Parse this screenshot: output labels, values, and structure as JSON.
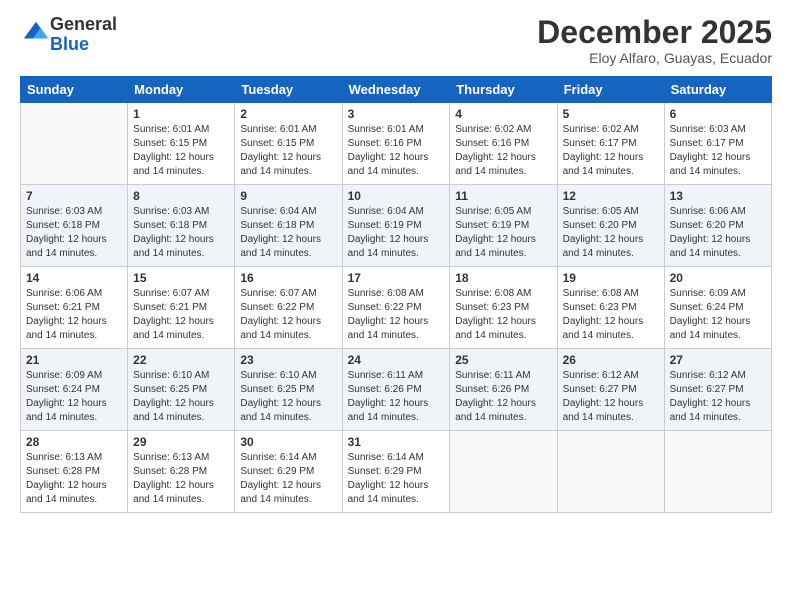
{
  "logo": {
    "general": "General",
    "blue": "Blue"
  },
  "header": {
    "month": "December 2025",
    "location": "Eloy Alfaro, Guayas, Ecuador"
  },
  "weekdays": [
    "Sunday",
    "Monday",
    "Tuesday",
    "Wednesday",
    "Thursday",
    "Friday",
    "Saturday"
  ],
  "weeks": [
    [
      {
        "day": "",
        "sunrise": "",
        "sunset": "",
        "daylight": ""
      },
      {
        "day": "1",
        "sunrise": "Sunrise: 6:01 AM",
        "sunset": "Sunset: 6:15 PM",
        "daylight": "Daylight: 12 hours and 14 minutes."
      },
      {
        "day": "2",
        "sunrise": "Sunrise: 6:01 AM",
        "sunset": "Sunset: 6:15 PM",
        "daylight": "Daylight: 12 hours and 14 minutes."
      },
      {
        "day": "3",
        "sunrise": "Sunrise: 6:01 AM",
        "sunset": "Sunset: 6:16 PM",
        "daylight": "Daylight: 12 hours and 14 minutes."
      },
      {
        "day": "4",
        "sunrise": "Sunrise: 6:02 AM",
        "sunset": "Sunset: 6:16 PM",
        "daylight": "Daylight: 12 hours and 14 minutes."
      },
      {
        "day": "5",
        "sunrise": "Sunrise: 6:02 AM",
        "sunset": "Sunset: 6:17 PM",
        "daylight": "Daylight: 12 hours and 14 minutes."
      },
      {
        "day": "6",
        "sunrise": "Sunrise: 6:03 AM",
        "sunset": "Sunset: 6:17 PM",
        "daylight": "Daylight: 12 hours and 14 minutes."
      }
    ],
    [
      {
        "day": "7",
        "sunrise": "Sunrise: 6:03 AM",
        "sunset": "Sunset: 6:18 PM",
        "daylight": "Daylight: 12 hours and 14 minutes."
      },
      {
        "day": "8",
        "sunrise": "Sunrise: 6:03 AM",
        "sunset": "Sunset: 6:18 PM",
        "daylight": "Daylight: 12 hours and 14 minutes."
      },
      {
        "day": "9",
        "sunrise": "Sunrise: 6:04 AM",
        "sunset": "Sunset: 6:18 PM",
        "daylight": "Daylight: 12 hours and 14 minutes."
      },
      {
        "day": "10",
        "sunrise": "Sunrise: 6:04 AM",
        "sunset": "Sunset: 6:19 PM",
        "daylight": "Daylight: 12 hours and 14 minutes."
      },
      {
        "day": "11",
        "sunrise": "Sunrise: 6:05 AM",
        "sunset": "Sunset: 6:19 PM",
        "daylight": "Daylight: 12 hours and 14 minutes."
      },
      {
        "day": "12",
        "sunrise": "Sunrise: 6:05 AM",
        "sunset": "Sunset: 6:20 PM",
        "daylight": "Daylight: 12 hours and 14 minutes."
      },
      {
        "day": "13",
        "sunrise": "Sunrise: 6:06 AM",
        "sunset": "Sunset: 6:20 PM",
        "daylight": "Daylight: 12 hours and 14 minutes."
      }
    ],
    [
      {
        "day": "14",
        "sunrise": "Sunrise: 6:06 AM",
        "sunset": "Sunset: 6:21 PM",
        "daylight": "Daylight: 12 hours and 14 minutes."
      },
      {
        "day": "15",
        "sunrise": "Sunrise: 6:07 AM",
        "sunset": "Sunset: 6:21 PM",
        "daylight": "Daylight: 12 hours and 14 minutes."
      },
      {
        "day": "16",
        "sunrise": "Sunrise: 6:07 AM",
        "sunset": "Sunset: 6:22 PM",
        "daylight": "Daylight: 12 hours and 14 minutes."
      },
      {
        "day": "17",
        "sunrise": "Sunrise: 6:08 AM",
        "sunset": "Sunset: 6:22 PM",
        "daylight": "Daylight: 12 hours and 14 minutes."
      },
      {
        "day": "18",
        "sunrise": "Sunrise: 6:08 AM",
        "sunset": "Sunset: 6:23 PM",
        "daylight": "Daylight: 12 hours and 14 minutes."
      },
      {
        "day": "19",
        "sunrise": "Sunrise: 6:08 AM",
        "sunset": "Sunset: 6:23 PM",
        "daylight": "Daylight: 12 hours and 14 minutes."
      },
      {
        "day": "20",
        "sunrise": "Sunrise: 6:09 AM",
        "sunset": "Sunset: 6:24 PM",
        "daylight": "Daylight: 12 hours and 14 minutes."
      }
    ],
    [
      {
        "day": "21",
        "sunrise": "Sunrise: 6:09 AM",
        "sunset": "Sunset: 6:24 PM",
        "daylight": "Daylight: 12 hours and 14 minutes."
      },
      {
        "day": "22",
        "sunrise": "Sunrise: 6:10 AM",
        "sunset": "Sunset: 6:25 PM",
        "daylight": "Daylight: 12 hours and 14 minutes."
      },
      {
        "day": "23",
        "sunrise": "Sunrise: 6:10 AM",
        "sunset": "Sunset: 6:25 PM",
        "daylight": "Daylight: 12 hours and 14 minutes."
      },
      {
        "day": "24",
        "sunrise": "Sunrise: 6:11 AM",
        "sunset": "Sunset: 6:26 PM",
        "daylight": "Daylight: 12 hours and 14 minutes."
      },
      {
        "day": "25",
        "sunrise": "Sunrise: 6:11 AM",
        "sunset": "Sunset: 6:26 PM",
        "daylight": "Daylight: 12 hours and 14 minutes."
      },
      {
        "day": "26",
        "sunrise": "Sunrise: 6:12 AM",
        "sunset": "Sunset: 6:27 PM",
        "daylight": "Daylight: 12 hours and 14 minutes."
      },
      {
        "day": "27",
        "sunrise": "Sunrise: 6:12 AM",
        "sunset": "Sunset: 6:27 PM",
        "daylight": "Daylight: 12 hours and 14 minutes."
      }
    ],
    [
      {
        "day": "28",
        "sunrise": "Sunrise: 6:13 AM",
        "sunset": "Sunset: 6:28 PM",
        "daylight": "Daylight: 12 hours and 14 minutes."
      },
      {
        "day": "29",
        "sunrise": "Sunrise: 6:13 AM",
        "sunset": "Sunset: 6:28 PM",
        "daylight": "Daylight: 12 hours and 14 minutes."
      },
      {
        "day": "30",
        "sunrise": "Sunrise: 6:14 AM",
        "sunset": "Sunset: 6:29 PM",
        "daylight": "Daylight: 12 hours and 14 minutes."
      },
      {
        "day": "31",
        "sunrise": "Sunrise: 6:14 AM",
        "sunset": "Sunset: 6:29 PM",
        "daylight": "Daylight: 12 hours and 14 minutes."
      },
      {
        "day": "",
        "sunrise": "",
        "sunset": "",
        "daylight": ""
      },
      {
        "day": "",
        "sunrise": "",
        "sunset": "",
        "daylight": ""
      },
      {
        "day": "",
        "sunrise": "",
        "sunset": "",
        "daylight": ""
      }
    ]
  ]
}
